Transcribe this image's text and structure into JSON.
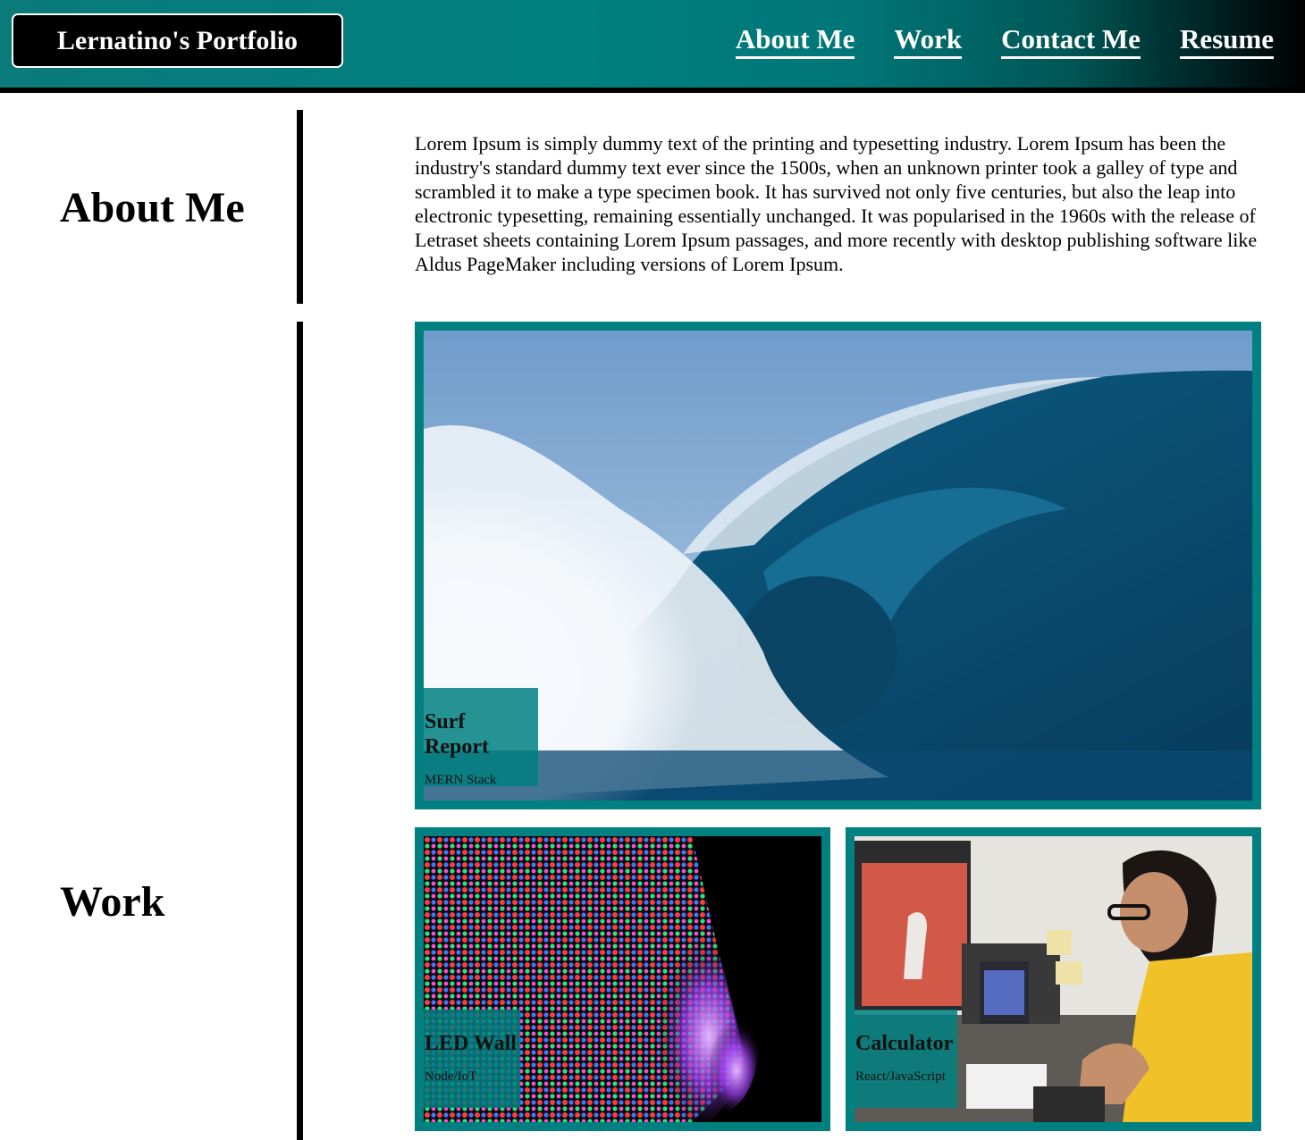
{
  "header": {
    "brand": "Lernatino's Portfolio",
    "nav": [
      "About Me",
      "Work",
      "Contact Me",
      "Resume"
    ]
  },
  "about": {
    "heading": "About Me",
    "text": "Lorem Ipsum is simply dummy text of the printing and typesetting industry. Lorem Ipsum has been the industry's standard dummy text ever since the 1500s, when an unknown printer took a galley of type and scrambled it to make a type specimen book. It has survived not only five centuries, but also the leap into electronic typesetting, remaining essentially unchanged. It was popularised in the 1960s with the release of Letraset sheets containing Lorem Ipsum passages, and more recently with desktop publishing software like Aldus PageMaker including versions of Lorem Ipsum."
  },
  "work": {
    "heading": "Work",
    "projects": [
      {
        "title": "Surf Report",
        "stack": "MERN Stack"
      },
      {
        "title": "LED Wall",
        "stack": "Node/IoT"
      },
      {
        "title": "Calculator",
        "stack": "React/JavaScript"
      }
    ]
  },
  "colors": {
    "accent": "#008080",
    "header_end": "#000000"
  }
}
